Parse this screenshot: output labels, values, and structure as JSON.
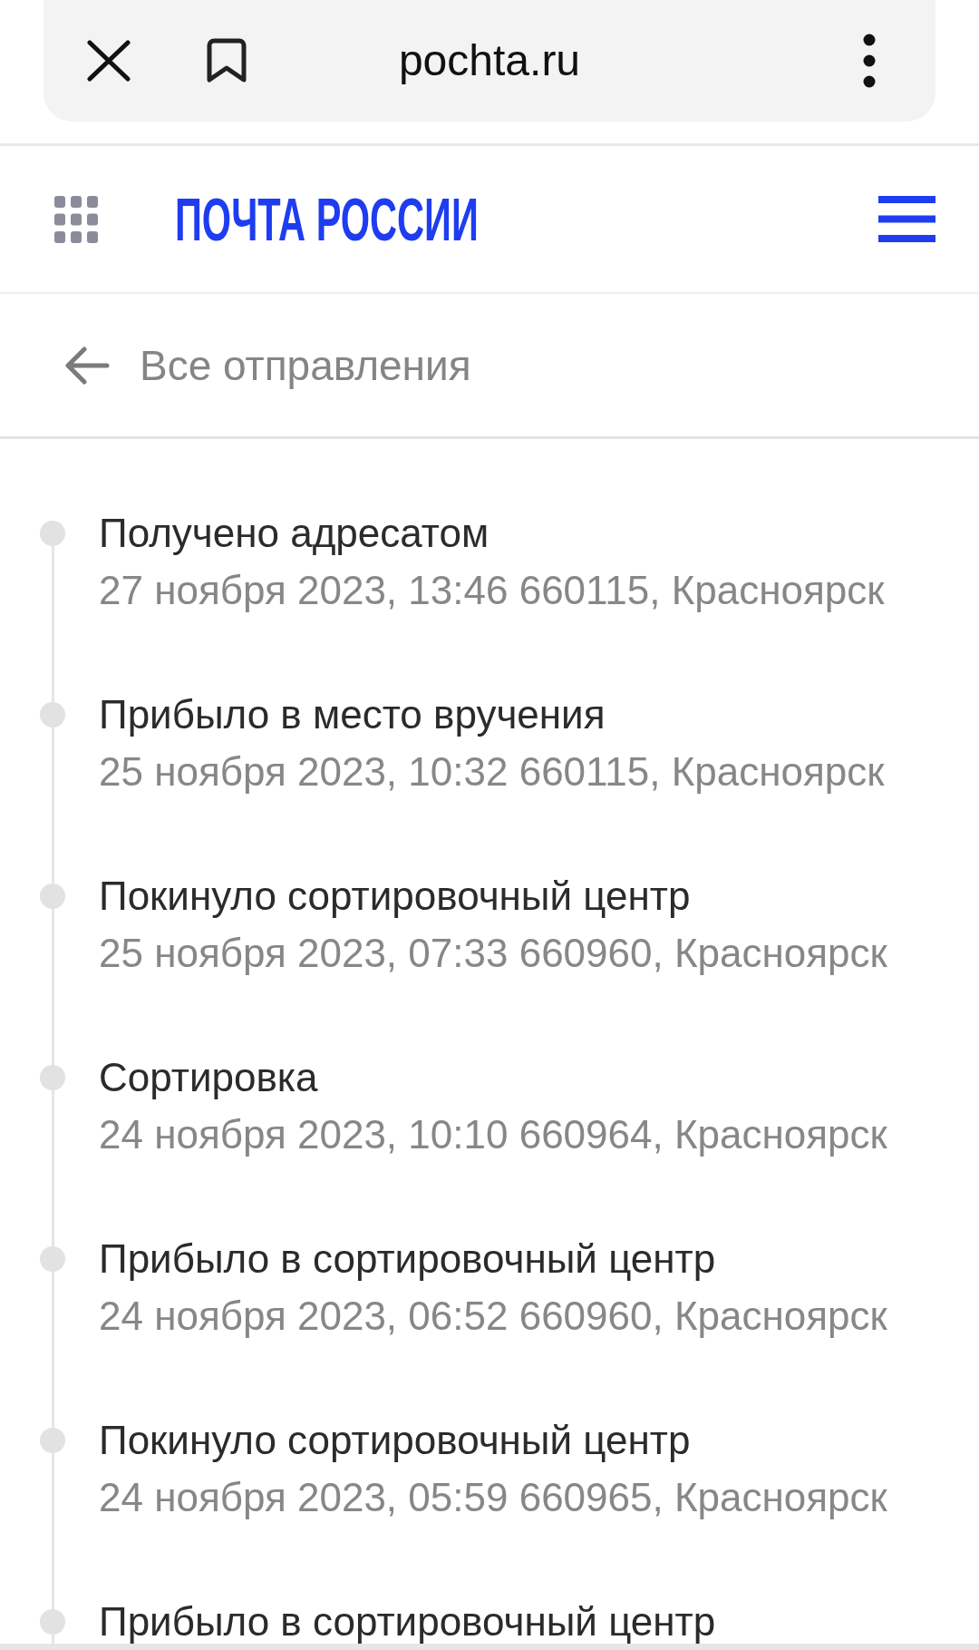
{
  "browser_bar": {
    "url": "pochta.ru"
  },
  "header": {
    "logo": "ПОЧТА РОССИИ"
  },
  "back_link": {
    "label": "Все отправления"
  },
  "events": [
    {
      "title": "Получено адресатом",
      "details": "27 ноября 2023, 13:46 660115, Красноярск"
    },
    {
      "title": "Прибыло в место вручения",
      "details": "25 ноября 2023, 10:32 660115, Красноярск"
    },
    {
      "title": "Покинуло сортировочный центр",
      "details": "25 ноября 2023, 07:33 660960, Красноярск"
    },
    {
      "title": "Сортировка",
      "details": "24 ноября 2023, 10:10 660964, Красноярск"
    },
    {
      "title": "Прибыло в сортировочный центр",
      "details": "24 ноября 2023, 06:52 660960, Красноярск"
    },
    {
      "title": "Покинуло сортировочный центр",
      "details": "24 ноября 2023, 05:59 660965, Красноярск"
    },
    {
      "title": "Прибыло в сортировочный центр"
    }
  ]
}
